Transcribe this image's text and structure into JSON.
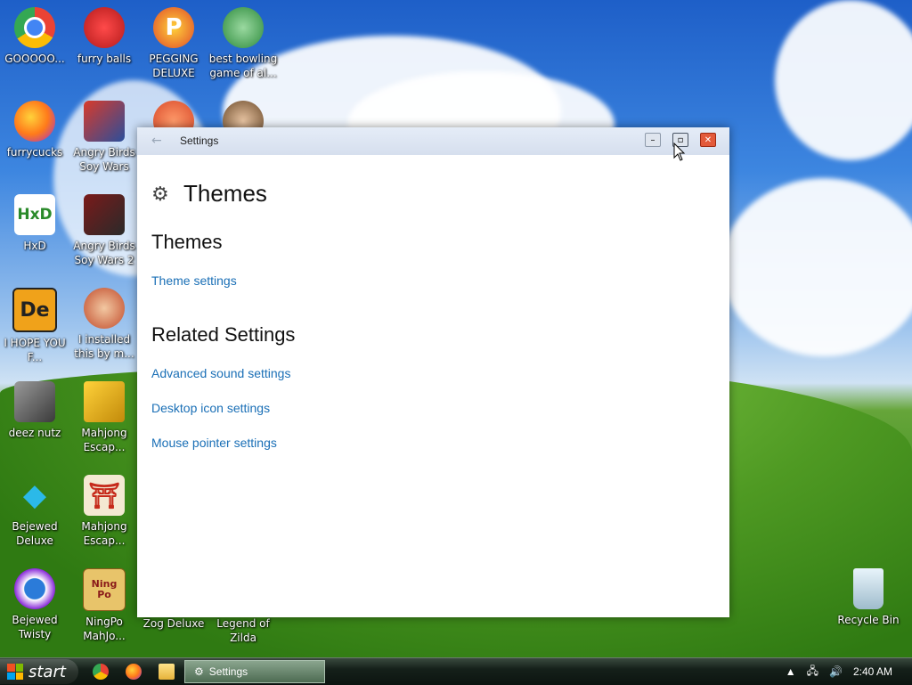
{
  "desktop": {
    "icons": [
      {
        "label": "GOOOOO...",
        "glyph": "",
        "color": "#4285f4"
      },
      {
        "label": "furry balls",
        "glyph": "",
        "color": "#d92b2b"
      },
      {
        "label": "PEGGING DELUXE",
        "glyph": "P",
        "color": "#e04a2a"
      },
      {
        "label": "best bowling game of al...",
        "glyph": "",
        "color": "#2d8a3c"
      },
      {
        "label": "furrycucks",
        "glyph": "",
        "color": "#ff7a1a"
      },
      {
        "label": "Angry Birds Soy Wars",
        "glyph": "",
        "color": "#2b4e9b"
      },
      {
        "label": "HxD",
        "glyph": "HxD",
        "color": "#ffffff"
      },
      {
        "label": "Angry Birds Soy Wars 2",
        "glyph": "",
        "color": "#7a1a1a"
      },
      {
        "label": "I HOPE YOU F...",
        "glyph": "De",
        "color": "#f0a21a"
      },
      {
        "label": "I installed this by m...",
        "glyph": "",
        "color": "#c14a2a"
      },
      {
        "label": "deez nutz",
        "glyph": "",
        "color": "#6b6b6b"
      },
      {
        "label": "Mahjong Escap...",
        "glyph": "",
        "color": "#e3b21a"
      },
      {
        "label": "Bejewed Deluxe",
        "glyph": "",
        "color": "#2bb9e8"
      },
      {
        "label": "Mahjong Escap...",
        "glyph": "⛩",
        "color": "#f4e9d2"
      },
      {
        "label": "Bejewed Twisty",
        "glyph": "",
        "color": "#8a2bd9"
      },
      {
        "label": "NingPo MahJo...",
        "glyph": "Ning Po",
        "color": "#e8c46a"
      },
      {
        "label": "Zog Deluxe",
        "glyph": "",
        "color": "#d84a2a"
      },
      {
        "label": "Legend of Zilda",
        "glyph": "",
        "color": "#6b4a2a"
      },
      {
        "label": "Recycle Bin",
        "glyph": "",
        "color": "#cfe3ee"
      }
    ]
  },
  "window": {
    "title": "Settings",
    "back": "←",
    "page_title": "Themes",
    "gear": "⚙",
    "section1": {
      "heading": "Themes",
      "links": [
        "Theme settings"
      ]
    },
    "section2": {
      "heading": "Related Settings",
      "links": [
        "Advanced sound settings",
        "Desktop icon settings",
        "Mouse pointer settings"
      ]
    },
    "controls": {
      "minimize": "–",
      "maximize": "▫",
      "close": "✕"
    }
  },
  "taskbar": {
    "start_label": "start",
    "active_task": "Settings",
    "time": "2:40 AM"
  },
  "colors": {
    "link": "#1a6fb6",
    "close": "#e35a3a"
  }
}
